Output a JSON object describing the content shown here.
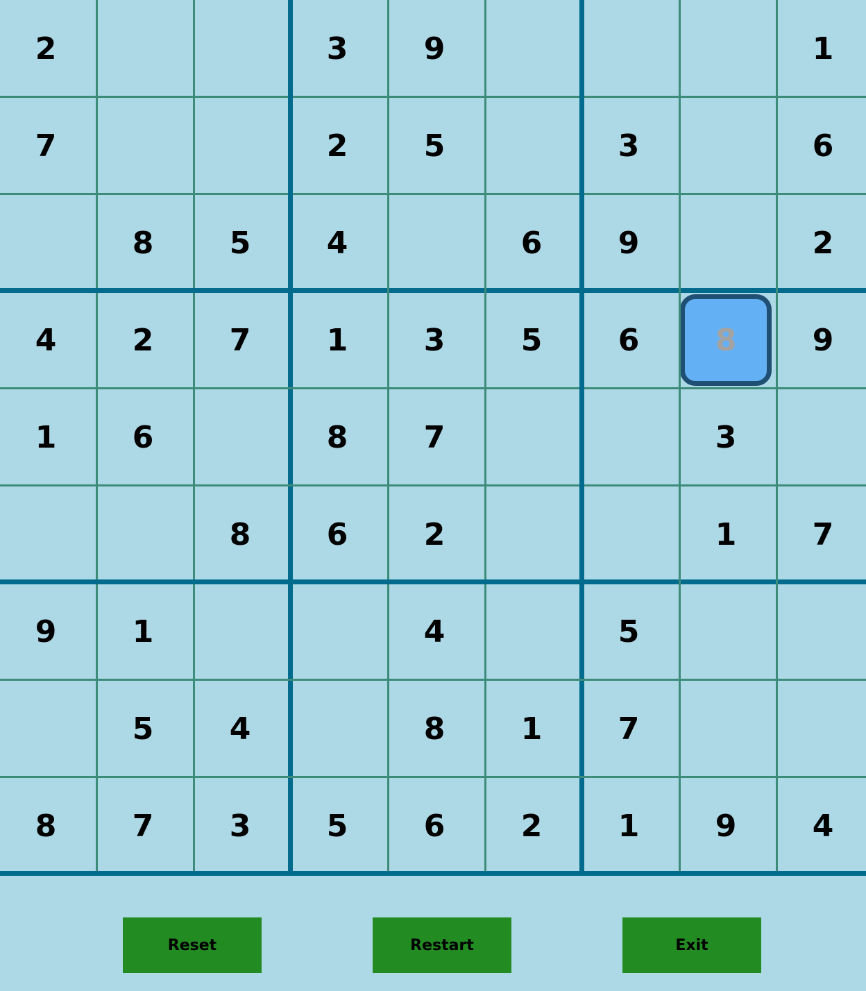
{
  "grid": [
    [
      "2",
      "",
      "",
      "3",
      "9",
      "",
      "",
      "",
      "1"
    ],
    [
      "7",
      "",
      "",
      "2",
      "5",
      "",
      "3",
      "",
      "6"
    ],
    [
      "",
      "8",
      "5",
      "4",
      "",
      "6",
      "9",
      "",
      "2"
    ],
    [
      "4",
      "2",
      "7",
      "1",
      "3",
      "5",
      "6",
      "8",
      "9"
    ],
    [
      "1",
      "6",
      "",
      "8",
      "7",
      "",
      "",
      "3",
      ""
    ],
    [
      "",
      "",
      "8",
      "6",
      "2",
      "",
      "",
      "1",
      "7"
    ],
    [
      "9",
      "1",
      "",
      "",
      "4",
      "",
      "5",
      "",
      ""
    ],
    [
      "",
      "5",
      "4",
      "",
      "8",
      "1",
      "7",
      "",
      ""
    ],
    [
      "8",
      "7",
      "3",
      "5",
      "6",
      "2",
      "1",
      "9",
      "4"
    ]
  ],
  "selected_cell": {
    "row": 3,
    "col": 7
  },
  "buttons": {
    "reset": "Reset",
    "restart": "Restart",
    "exit": "Exit"
  },
  "colors": {
    "background": "#add8e6",
    "thin_grid": "#3d8c7a",
    "thick_grid": "#006b8c",
    "button": "#228b22",
    "selected_fill": "#64b0f4",
    "selected_border": "#1f4f72",
    "selected_text": "#a3a3a3"
  }
}
